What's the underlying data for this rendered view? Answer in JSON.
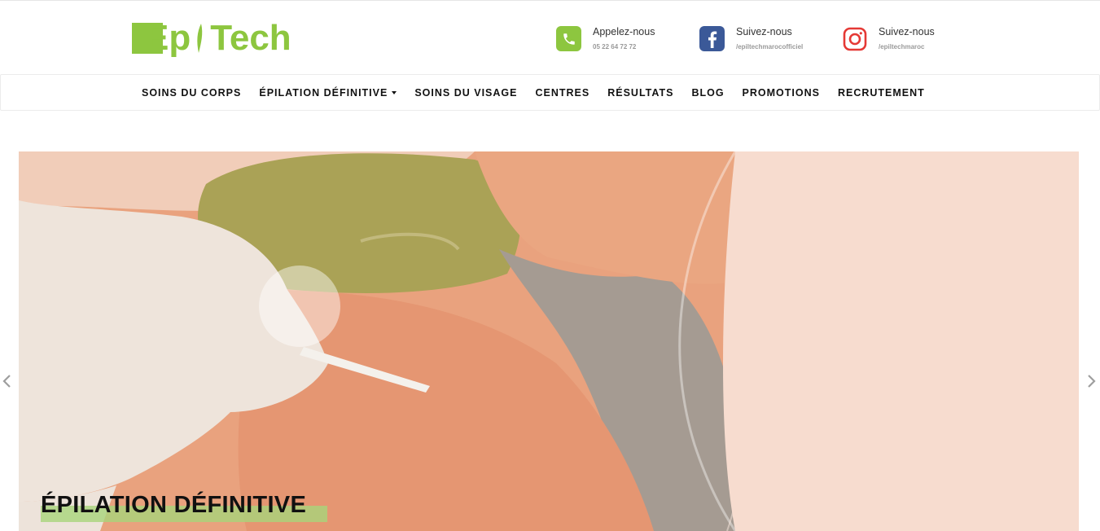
{
  "header": {
    "logo": {
      "text_e": "Ep",
      "text_tech": "Tech",
      "brand_color": "#8dc63f"
    },
    "contacts": [
      {
        "icon": "phone-icon",
        "title": "Appelez-nous",
        "sub": "05 22 64 72 72",
        "color": "#8dc63f"
      },
      {
        "icon": "facebook-icon",
        "title": "Suivez-nous",
        "sub": "/epiltechmarocofficiel",
        "color": "#3b5998"
      },
      {
        "icon": "instagram-icon",
        "title": "Suivez-nous",
        "sub": "/epiltechmaroc",
        "color": "#e1306c"
      }
    ]
  },
  "nav": {
    "items": [
      {
        "label": "SOINS DU CORPS"
      },
      {
        "label": "ÉPILATION DÉFINITIVE",
        "dropdown": true
      },
      {
        "label": "SOINS DU VISAGE"
      },
      {
        "label": "CENTRES"
      },
      {
        "label": "RÉSULTATS"
      },
      {
        "label": "BLOG"
      },
      {
        "label": "PROMOTIONS"
      },
      {
        "label": "RECRUTEMENT"
      }
    ]
  },
  "hero": {
    "caption": "ÉPILATION DÉFINITIVE",
    "accent_color": "#a8d47a",
    "overlay_color": "#f7dccf"
  }
}
